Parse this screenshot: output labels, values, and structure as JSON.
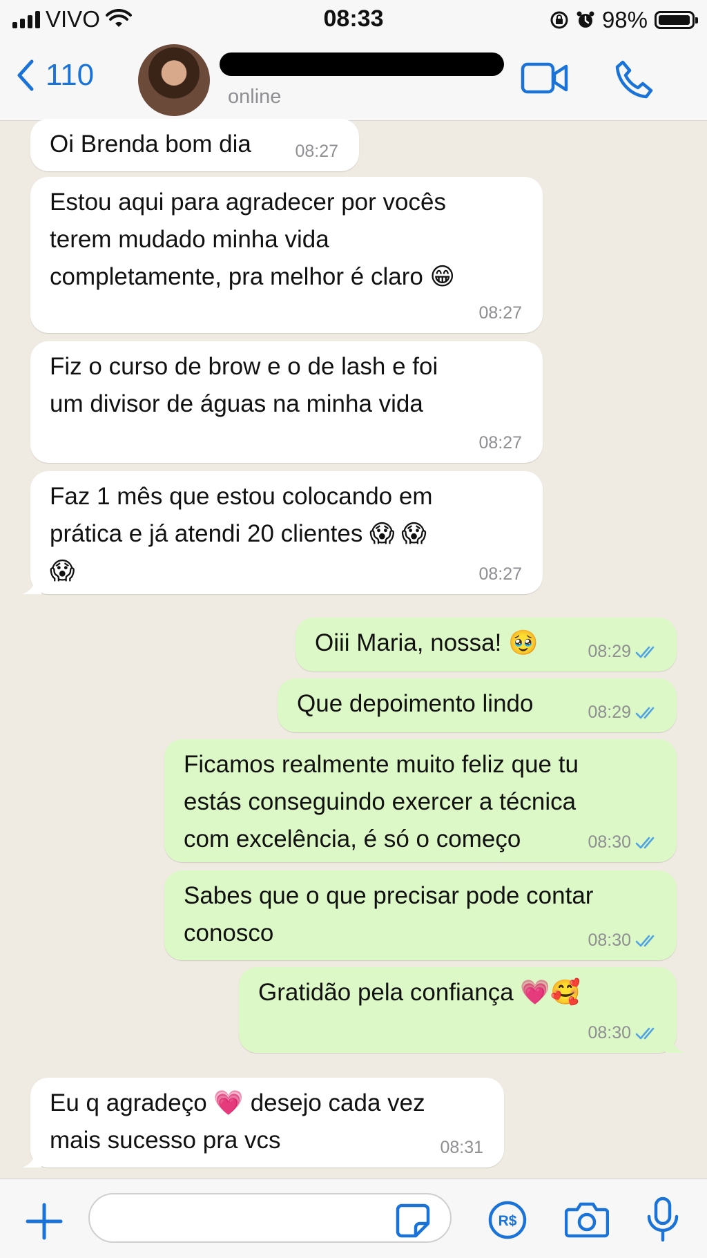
{
  "status_bar": {
    "carrier": "VIVO",
    "time": "08:33",
    "battery": "98%",
    "battery_level": 0.98
  },
  "header": {
    "back_count": "110",
    "contact_status": "online"
  },
  "messages": [
    {
      "direction": "in",
      "lines": [
        "Oi Brenda bom dia"
      ],
      "time": "08:27"
    },
    {
      "direction": "in",
      "lines": [
        "Estou aqui para agradecer por vocês",
        "terem mudado minha vida",
        "completamente, pra melhor é claro 😁"
      ],
      "time": "08:27"
    },
    {
      "direction": "in",
      "lines": [
        "Fiz o curso de brow e o de lash e foi",
        "um divisor de águas na minha vida"
      ],
      "time": "08:27"
    },
    {
      "direction": "in",
      "lines": [
        "Faz 1 mês que estou colocando em",
        "prática e já atendi 20 clientes 😱 😱",
        "😱"
      ],
      "time": "08:27"
    },
    {
      "direction": "out",
      "lines": [
        "Oiii Maria, nossa! 🥹"
      ],
      "time": "08:29"
    },
    {
      "direction": "out",
      "lines": [
        "Que depoimento lindo"
      ],
      "time": "08:29"
    },
    {
      "direction": "out",
      "lines": [
        "Ficamos realmente muito feliz que tu",
        "estás conseguindo exercer a técnica",
        "com excelência, é só o começo"
      ],
      "time": "08:30"
    },
    {
      "direction": "out",
      "lines": [
        "Sabes que o que precisar pode contar",
        "conosco"
      ],
      "time": "08:30"
    },
    {
      "direction": "out",
      "lines": [
        "Gratidão pela confiança 💗🥰"
      ],
      "time": "08:30"
    },
    {
      "direction": "in",
      "lines": [
        "Eu q agradeço 💗 desejo cada vez",
        "mais sucesso pra vcs"
      ],
      "time": "08:31"
    }
  ],
  "input": {
    "placeholder": ""
  },
  "icons": {
    "back": "chevron-left-icon",
    "video": "video-call-icon",
    "phone": "phone-call-icon",
    "plus": "plus-icon",
    "sticker": "sticker-icon",
    "payment": "payment-icon",
    "camera": "camera-icon",
    "mic": "microphone-icon"
  },
  "colors": {
    "accent": "#1a73d9",
    "incoming": "#ffffff",
    "outgoing": "#dcf8c6",
    "read_ticks": "#4fa3e3",
    "wallpaper": "#efeae2"
  }
}
